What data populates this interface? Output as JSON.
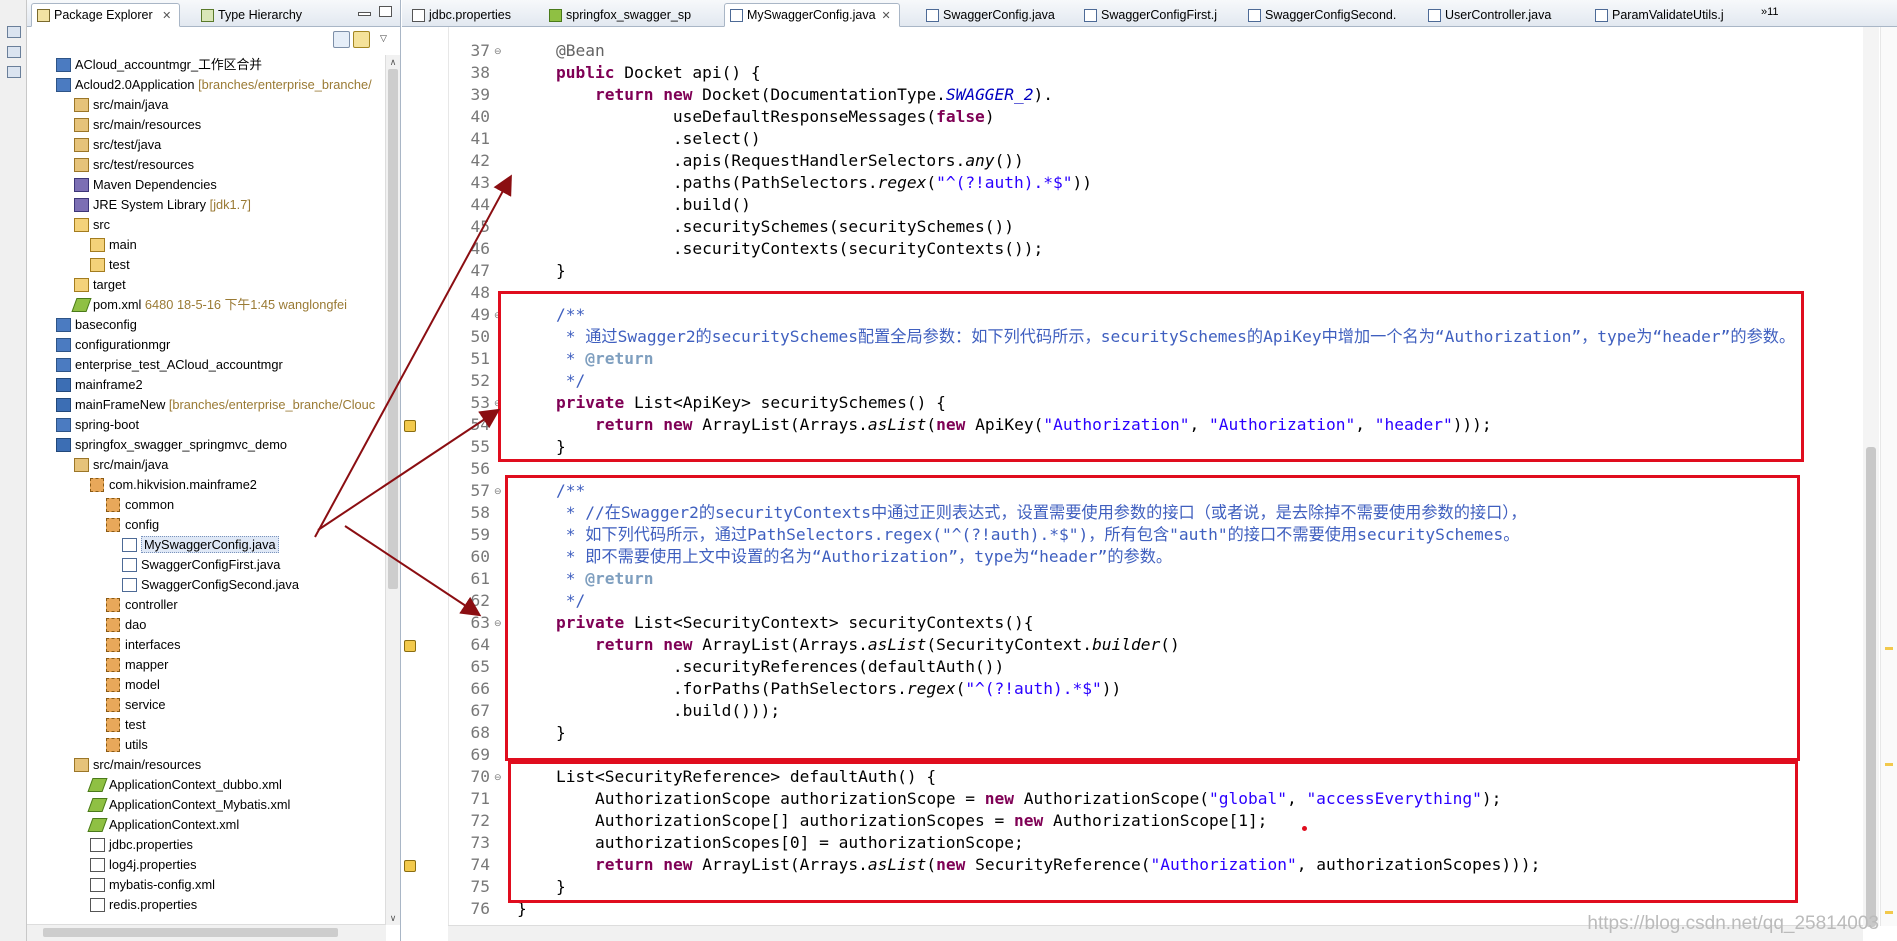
{
  "package_explorer": {
    "tabs": [
      {
        "label": "Package Explorer",
        "close": "✕"
      },
      {
        "label": "Type Hierarchy"
      }
    ],
    "tree": [
      {
        "label": "ACloud_accountmgr_工作区合并",
        "decoration": "",
        "icon": "proj",
        "indent": 0
      },
      {
        "label": "Acloud2.0Application",
        "decoration": "[branches/enterprise_branche/",
        "icon": "proj",
        "indent": 0
      },
      {
        "label": "src/main/java",
        "decoration": "",
        "icon": "src",
        "indent": 1
      },
      {
        "label": "src/main/resources",
        "decoration": "",
        "icon": "src",
        "indent": 1
      },
      {
        "label": "src/test/java",
        "decoration": "",
        "icon": "src",
        "indent": 1
      },
      {
        "label": "src/test/resources",
        "decoration": "",
        "icon": "src",
        "indent": 1
      },
      {
        "label": "Maven Dependencies",
        "decoration": "",
        "icon": "lib",
        "indent": 1
      },
      {
        "label": "JRE System Library",
        "decoration": "[jdk1.7]",
        "icon": "lib",
        "indent": 1
      },
      {
        "label": "src",
        "decoration": "",
        "icon": "folder",
        "indent": 1
      },
      {
        "label": "main",
        "decoration": "",
        "icon": "folder",
        "indent": 2
      },
      {
        "label": "test",
        "decoration": "",
        "icon": "folder",
        "indent": 2
      },
      {
        "label": "target",
        "decoration": "",
        "icon": "folder",
        "indent": 1
      },
      {
        "label": "pom.xml",
        "decoration": "6480  18-5-16 下午1:45  wanglongfei",
        "icon": "xml",
        "indent": 1
      },
      {
        "label": "baseconfig",
        "decoration": "",
        "icon": "proj",
        "indent": 0
      },
      {
        "label": "configurationmgr",
        "decoration": "",
        "icon": "proj",
        "indent": 0
      },
      {
        "label": "enterprise_test_ACloud_accountmgr",
        "decoration": "",
        "icon": "proj",
        "indent": 0
      },
      {
        "label": "mainframe2",
        "decoration": "",
        "icon": "jproj",
        "indent": 0
      },
      {
        "label": "mainFrameNew",
        "decoration": "[branches/enterprise_branche/Clouc",
        "icon": "jproj",
        "indent": 0
      },
      {
        "label": "spring-boot",
        "decoration": "",
        "icon": "proj",
        "indent": 0
      },
      {
        "label": "springfox_swagger_springmvc_demo",
        "decoration": "",
        "icon": "jproj",
        "indent": 0
      },
      {
        "label": "src/main/java",
        "decoration": "",
        "icon": "src",
        "indent": 1
      },
      {
        "label": "com.hikvision.mainframe2",
        "decoration": "",
        "icon": "pkg",
        "indent": 2
      },
      {
        "label": "common",
        "decoration": "",
        "icon": "pkg",
        "indent": 3
      },
      {
        "label": "config",
        "decoration": "",
        "icon": "pkg",
        "indent": 3
      },
      {
        "label": "MySwaggerConfig.java",
        "decoration": "",
        "icon": "jfile",
        "indent": 4,
        "selected": true
      },
      {
        "label": "SwaggerConfigFirst.java",
        "decoration": "",
        "icon": "jfile",
        "indent": 4
      },
      {
        "label": "SwaggerConfigSecond.java",
        "decoration": "",
        "icon": "jfile",
        "indent": 4
      },
      {
        "label": "controller",
        "decoration": "",
        "icon": "pkg",
        "indent": 3
      },
      {
        "label": "dao",
        "decoration": "",
        "icon": "pkg",
        "indent": 3
      },
      {
        "label": "interfaces",
        "decoration": "",
        "icon": "pkg",
        "indent": 3
      },
      {
        "label": "mapper",
        "decoration": "",
        "icon": "pkg",
        "indent": 3
      },
      {
        "label": "model",
        "decoration": "",
        "icon": "pkg",
        "indent": 3
      },
      {
        "label": "service",
        "decoration": "",
        "icon": "pkg",
        "indent": 3
      },
      {
        "label": "test",
        "decoration": "",
        "icon": "pkg",
        "indent": 3
      },
      {
        "label": "utils",
        "decoration": "",
        "icon": "pkg",
        "indent": 3
      },
      {
        "label": "src/main/resources",
        "decoration": "",
        "icon": "src",
        "indent": 1
      },
      {
        "label": "ApplicationContext_dubbo.xml",
        "decoration": "",
        "icon": "xml",
        "indent": 2
      },
      {
        "label": "ApplicationContext_Mybatis.xml",
        "decoration": "",
        "icon": "xml",
        "indent": 2
      },
      {
        "label": "ApplicationContext.xml",
        "decoration": "",
        "icon": "xml",
        "indent": 2
      },
      {
        "label": "jdbc.properties",
        "decoration": "",
        "icon": "props",
        "indent": 2
      },
      {
        "label": "log4j.properties",
        "decoration": "",
        "icon": "props",
        "indent": 2
      },
      {
        "label": "mybatis-config.xml",
        "decoration": "",
        "icon": "props",
        "indent": 2
      },
      {
        "label": "redis.properties",
        "decoration": "",
        "icon": "props",
        "indent": 2
      }
    ]
  },
  "editor": {
    "tabs": [
      {
        "label": "jdbc.properties",
        "active": false
      },
      {
        "label": "springfox_swagger_sp",
        "active": false
      },
      {
        "label": "MySwaggerConfig.java",
        "active": true,
        "close": "✕"
      },
      {
        "label": "SwaggerConfig.java",
        "active": false
      },
      {
        "label": "SwaggerConfigFirst.j",
        "active": false
      },
      {
        "label": "SwaggerConfigSecond.",
        "active": false
      },
      {
        "label": "UserController.java",
        "active": false
      },
      {
        "label": "ParamValidateUtils.j",
        "active": false
      }
    ],
    "overflow": "»11",
    "lines": [
      {
        "n": "37",
        "fold": "⊖",
        "parts": [
          [
            "ann",
            "    @Bean"
          ]
        ]
      },
      {
        "n": "38",
        "parts": [
          [
            "",
            "    "
          ],
          [
            "kw",
            "public"
          ],
          [
            "",
            " Docket api() {"
          ]
        ]
      },
      {
        "n": "39",
        "parts": [
          [
            "",
            "        "
          ],
          [
            "kw",
            "return"
          ],
          [
            "",
            ""
          ],
          [
            "kw",
            " new"
          ],
          [
            "",
            " Docket(DocumentationType."
          ],
          [
            "stat",
            "SWAGGER_2"
          ],
          [
            "",
            ")."
          ]
        ]
      },
      {
        "n": "40",
        "parts": [
          [
            "",
            "                useDefaultResponseMessages("
          ],
          [
            "kw",
            "false"
          ],
          [
            "",
            ")"
          ]
        ]
      },
      {
        "n": "41",
        "parts": [
          [
            "",
            "                .select()"
          ]
        ]
      },
      {
        "n": "42",
        "parts": [
          [
            "",
            "                .apis(RequestHandlerSelectors."
          ],
          [
            "it",
            "any"
          ],
          [
            "",
            "())"
          ]
        ]
      },
      {
        "n": "43",
        "parts": [
          [
            "",
            "                .paths(PathSelectors."
          ],
          [
            "it",
            "regex"
          ],
          [
            "",
            "("
          ],
          [
            "str",
            "\"^(?!auth).*$\""
          ],
          [
            "",
            "))"
          ]
        ]
      },
      {
        "n": "44",
        "parts": [
          [
            "",
            "                .build()"
          ]
        ]
      },
      {
        "n": "45",
        "parts": [
          [
            "",
            "                .securitySchemes(securitySchemes())"
          ]
        ]
      },
      {
        "n": "46",
        "parts": [
          [
            "",
            "                .securityContexts(securityContexts());"
          ]
        ]
      },
      {
        "n": "47",
        "parts": [
          [
            "",
            "    }"
          ]
        ]
      },
      {
        "n": "48",
        "parts": [
          [
            "",
            ""
          ]
        ]
      },
      {
        "n": "49",
        "fold": "⊖",
        "parts": [
          [
            "cm",
            "    /**"
          ]
        ]
      },
      {
        "n": "50",
        "parts": [
          [
            "cm",
            "     * 通过Swagger2的securitySchemes配置全局参数：如下列代码所示，securitySchemes的ApiKey中增加一个名为“Authorization”，type为“header”的参数。"
          ]
        ]
      },
      {
        "n": "51",
        "parts": [
          [
            "cm",
            "     * "
          ],
          [
            "ctag",
            "@return"
          ]
        ]
      },
      {
        "n": "52",
        "parts": [
          [
            "cm",
            "     */"
          ]
        ]
      },
      {
        "n": "53",
        "fold": "⊖",
        "parts": [
          [
            "",
            "    "
          ],
          [
            "kw",
            "private"
          ],
          [
            "",
            " List<ApiKey> securitySchemes() {"
          ]
        ]
      },
      {
        "n": "54",
        "warn": true,
        "parts": [
          [
            "",
            "        "
          ],
          [
            "kw",
            "return"
          ],
          [
            "",
            " "
          ],
          [
            "kw",
            "new"
          ],
          [
            "",
            " ArrayList(Arrays."
          ],
          [
            "it",
            "asList"
          ],
          [
            "",
            "("
          ],
          [
            "kw",
            "new"
          ],
          [
            "",
            " ApiKey("
          ],
          [
            "str",
            "\"Authorization\""
          ],
          [
            "",
            ", "
          ],
          [
            "str",
            "\"Authorization\""
          ],
          [
            "",
            ", "
          ],
          [
            "str",
            "\"header\""
          ],
          [
            "",
            ")));"
          ]
        ]
      },
      {
        "n": "55",
        "parts": [
          [
            "",
            "    }"
          ]
        ]
      },
      {
        "n": "56",
        "parts": [
          [
            "",
            ""
          ]
        ]
      },
      {
        "n": "57",
        "fold": "⊖",
        "parts": [
          [
            "cm",
            "    /**"
          ]
        ]
      },
      {
        "n": "58",
        "parts": [
          [
            "cm",
            "     * //在Swagger2的securityContexts中通过正则表达式，设置需要使用参数的接口（或者说，是去除掉不需要使用参数的接口），"
          ]
        ]
      },
      {
        "n": "59",
        "parts": [
          [
            "cm",
            "     * 如下列代码所示，通过PathSelectors.regex(\"^(?!auth).*$\")，所有包含\"auth\"的接口不需要使用securitySchemes。"
          ]
        ]
      },
      {
        "n": "60",
        "parts": [
          [
            "cm",
            "     * 即不需要使用上文中设置的名为“Authorization”，type为“header”的参数。"
          ]
        ]
      },
      {
        "n": "61",
        "parts": [
          [
            "cm",
            "     * "
          ],
          [
            "ctag",
            "@return"
          ]
        ]
      },
      {
        "n": "62",
        "parts": [
          [
            "cm",
            "     */"
          ]
        ]
      },
      {
        "n": "63",
        "fold": "⊖",
        "parts": [
          [
            "",
            "    "
          ],
          [
            "kw",
            "private"
          ],
          [
            "",
            " List<SecurityContext> securityContexts(){"
          ]
        ]
      },
      {
        "n": "64",
        "warn": true,
        "parts": [
          [
            "",
            "        "
          ],
          [
            "kw",
            "return"
          ],
          [
            "",
            " "
          ],
          [
            "kw",
            "new"
          ],
          [
            "",
            " ArrayList(Arrays."
          ],
          [
            "it",
            "asList"
          ],
          [
            "",
            "(SecurityContext."
          ],
          [
            "it",
            "builder"
          ],
          [
            "",
            "()"
          ]
        ]
      },
      {
        "n": "65",
        "parts": [
          [
            "",
            "                .securityReferences(defaultAuth())"
          ]
        ]
      },
      {
        "n": "66",
        "parts": [
          [
            "",
            "                .forPaths(PathSelectors."
          ],
          [
            "it",
            "regex"
          ],
          [
            "",
            "("
          ],
          [
            "str",
            "\"^(?!auth).*$\""
          ],
          [
            "",
            "))"
          ]
        ]
      },
      {
        "n": "67",
        "parts": [
          [
            "",
            "                .build()));"
          ]
        ]
      },
      {
        "n": "68",
        "parts": [
          [
            "",
            "    }"
          ]
        ]
      },
      {
        "n": "69",
        "parts": [
          [
            "",
            ""
          ]
        ]
      },
      {
        "n": "70",
        "fold": "⊖",
        "parts": [
          [
            "",
            "    List<SecurityReference> defaultAuth() {"
          ]
        ]
      },
      {
        "n": "71",
        "parts": [
          [
            "",
            "        AuthorizationScope authorizationScope = "
          ],
          [
            "kw",
            "new"
          ],
          [
            "",
            " AuthorizationScope("
          ],
          [
            "str",
            "\"global\""
          ],
          [
            "",
            ", "
          ],
          [
            "str",
            "\"accessEverything\""
          ],
          [
            "",
            ");"
          ]
        ]
      },
      {
        "n": "72",
        "parts": [
          [
            "",
            "        AuthorizationScope[] authorizationScopes = "
          ],
          [
            "kw",
            "new"
          ],
          [
            "",
            " AuthorizationScope[1];"
          ]
        ]
      },
      {
        "n": "73",
        "parts": [
          [
            "",
            "        authorizationScopes[0] = authorizationScope;"
          ]
        ]
      },
      {
        "n": "74",
        "warn": true,
        "parts": [
          [
            "",
            "        "
          ],
          [
            "kw",
            "return"
          ],
          [
            "",
            " "
          ],
          [
            "kw",
            "new"
          ],
          [
            "",
            " ArrayList(Arrays."
          ],
          [
            "it",
            "asList"
          ],
          [
            "",
            "("
          ],
          [
            "kw",
            "new"
          ],
          [
            "",
            " SecurityReference("
          ],
          [
            "str",
            "\"Authorization\""
          ],
          [
            "",
            ", authorizationScopes)));"
          ]
        ]
      },
      {
        "n": "75",
        "parts": [
          [
            "",
            "    }"
          ]
        ]
      },
      {
        "n": "76",
        "parts": [
          [
            "",
            "}"
          ]
        ]
      }
    ]
  },
  "watermark": "https://blog.csdn.net/qq_25814003",
  "colors": {
    "highlight_box": "#e00d1e",
    "arrow": "#8b0e12",
    "keyword": "#7f0055",
    "string": "#2a00ff",
    "comment": "#3f5fbf"
  }
}
